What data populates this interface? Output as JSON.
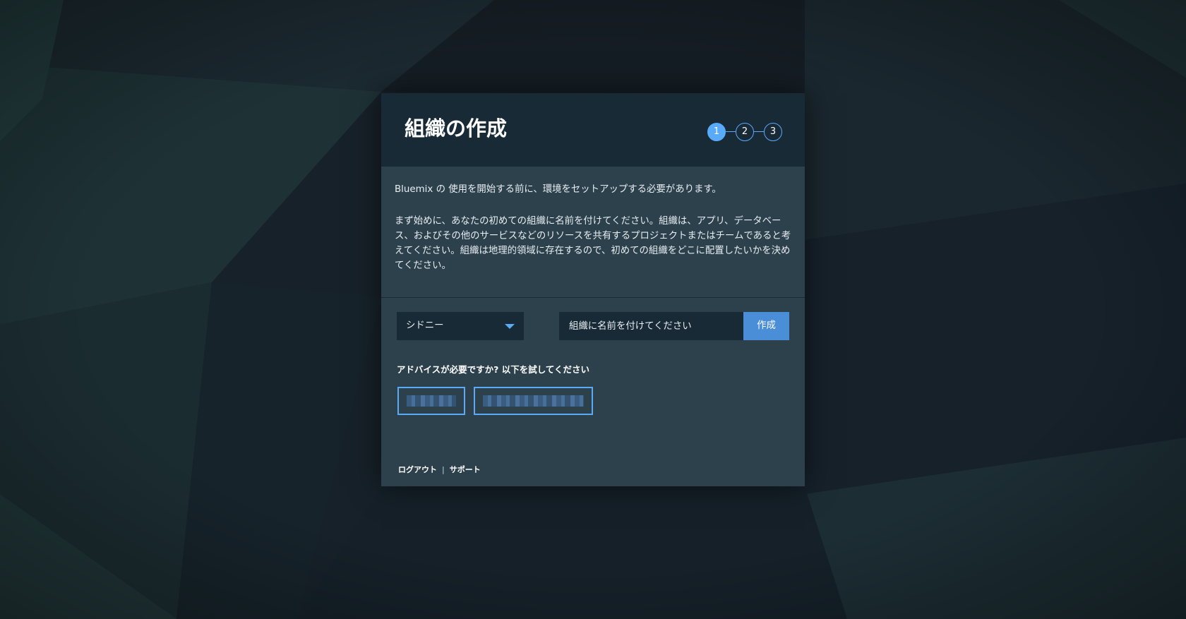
{
  "dialog": {
    "title": "組織の作成",
    "steps": [
      "1",
      "2",
      "3"
    ],
    "active_step": "1",
    "intro": "Bluemix の 使用を開始する前に、環境をセットアップする必要があります。",
    "description": "まず始めに、あなたの初めての組織に名前を付けてください。組織は、アプリ、データベース、およびその他のサービスなどのリソースを共有するプロジェクトまたはチームであると考えてください。組織は地理的領域に存在するので、初めての組織をどこに配置したいかを決めてください。",
    "region_select": {
      "selected": "シドニー"
    },
    "org_name_input": {
      "value": "",
      "placeholder": "組織に名前を付けてください"
    },
    "create_button": "作成",
    "advice_label": "アドバイスが必要ですか? 以下を試してください",
    "advice_links": [
      "",
      ""
    ],
    "footer": {
      "logout": "ログアウト",
      "separator": "|",
      "support": "サポート"
    }
  },
  "colors": {
    "accent": "#5aaafa",
    "button": "#4b8ed8",
    "header_bg": "#172a35",
    "panel_bg": "#2d414d",
    "page_bg": "#172129"
  }
}
